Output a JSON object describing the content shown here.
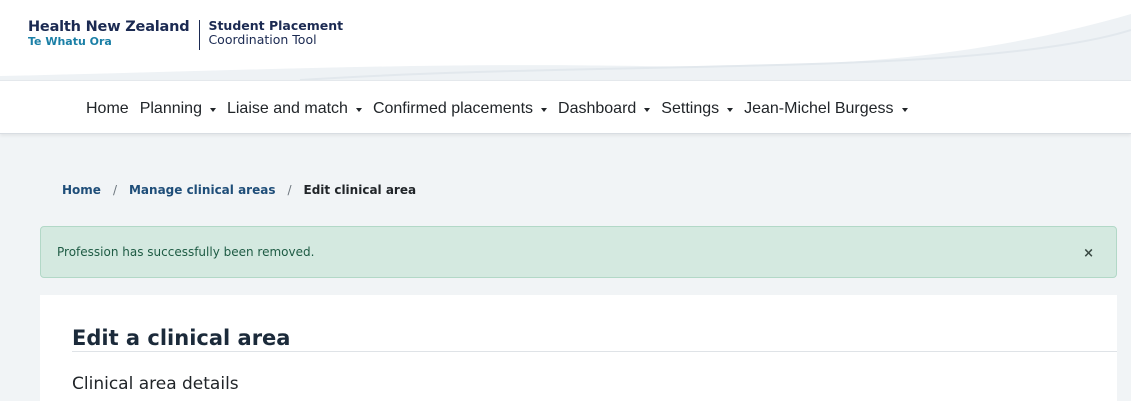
{
  "brand": {
    "name": "Health New Zealand",
    "subname": "Te Whatu Ora",
    "tool_title": "Student Placement",
    "tool_subtitle": "Coordination Tool"
  },
  "nav": {
    "items": [
      {
        "label": "Home",
        "dropdown": false
      },
      {
        "label": "Planning",
        "dropdown": true
      },
      {
        "label": "Liaise and match",
        "dropdown": true
      },
      {
        "label": "Confirmed placements",
        "dropdown": true
      },
      {
        "label": "Dashboard",
        "dropdown": true
      },
      {
        "label": "Settings",
        "dropdown": true
      },
      {
        "label": "Jean-Michel Burgess",
        "dropdown": true
      }
    ]
  },
  "breadcrumb": {
    "home": "Home",
    "separator": "/",
    "manage": "Manage clinical areas",
    "current": "Edit clinical area"
  },
  "alert": {
    "message": "Profession has successfully been removed.",
    "close": "×"
  },
  "page": {
    "title": "Edit a clinical area",
    "section_title": "Clinical area details"
  },
  "colors": {
    "brand_navy": "#1b2a52",
    "brand_teal": "#1a7fa6",
    "link": "#1f4e79",
    "alert_bg": "#d4e9e0",
    "alert_text": "#1e5b44",
    "page_bg": "#f1f4f6"
  }
}
